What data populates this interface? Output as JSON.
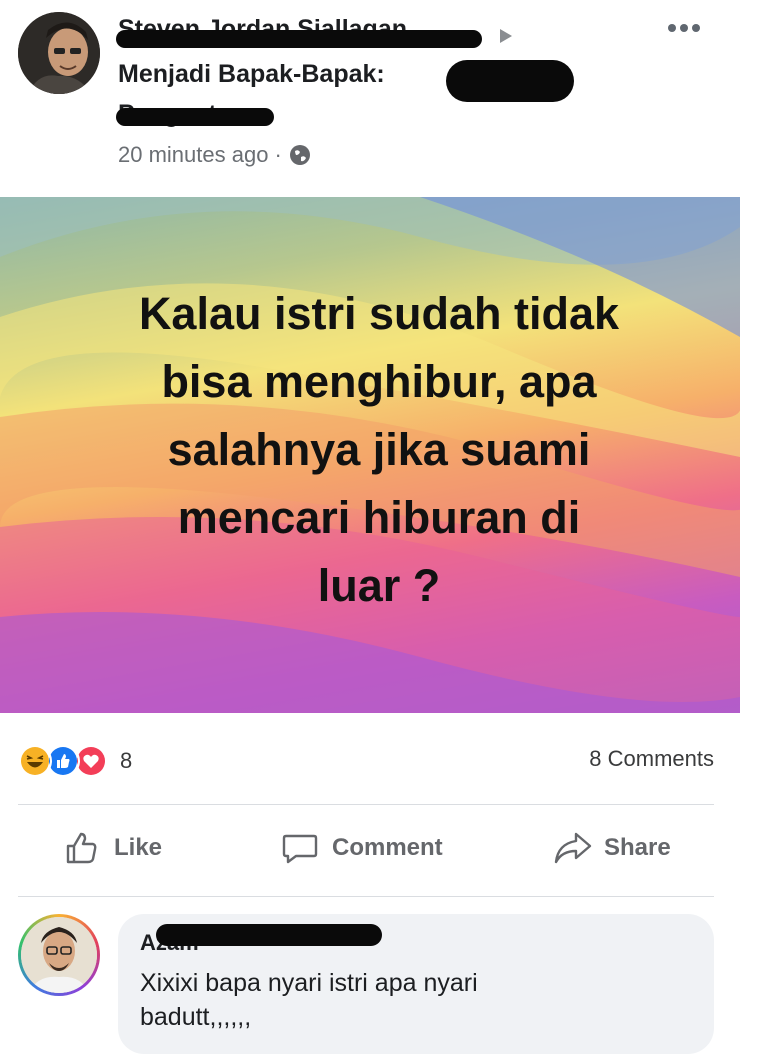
{
  "post": {
    "author_name": "Steven Jordan Siallagan",
    "group_prefix": "Menjadi Bapak-Bapak:",
    "group_tail": "Pengantar",
    "timestamp": "20 minutes ago",
    "separator": "·",
    "text": "Kalau istri sudah tidak\nbisa menghibur, apa\nsalahnya jika suami\nmencari hiburan di\nluar ?"
  },
  "stats": {
    "reaction_count": "8",
    "comments_count": "8 Comments"
  },
  "actions": {
    "like": "Like",
    "comment": "Comment",
    "share": "Share"
  },
  "comment": {
    "name": "Azam",
    "text": "Xixixi bapa nyari istri apa nyari\nbadutt,,,,,,"
  },
  "colors": {
    "like_blue": "#1877f2",
    "love_red": "#f33e58",
    "haha_yellow": "#f7b125",
    "muted_text": "#65676b"
  }
}
